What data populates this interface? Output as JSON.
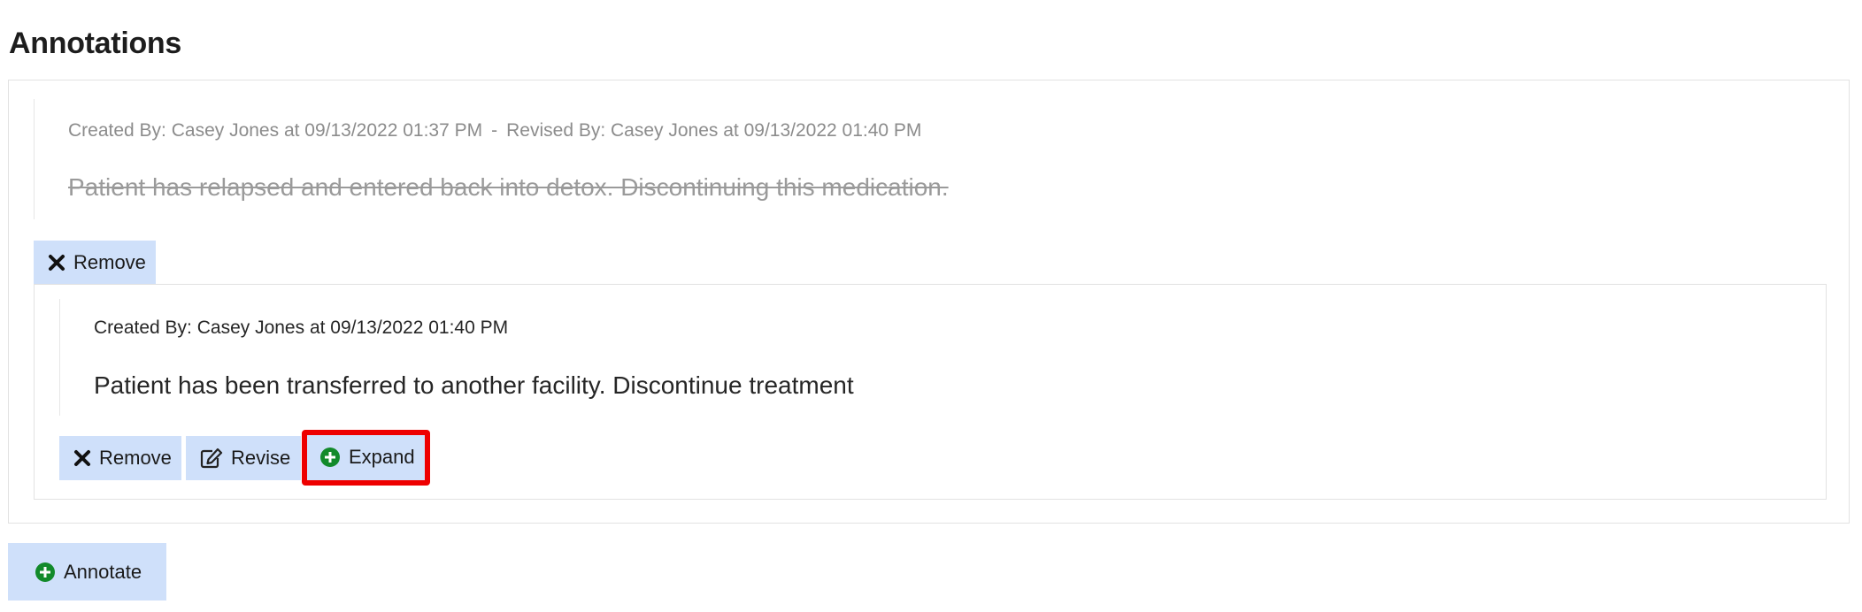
{
  "section_title": "Annotations",
  "annotations": [
    {
      "created": "Created By: Casey Jones at 09/13/2022 01:37 PM",
      "separator": "-",
      "revised": "Revised By: Casey Jones at 09/13/2022 01:40 PM",
      "text": "Patient has relapsed and entered back into detox. Discontinuing this medication.",
      "status": "revised",
      "actions": {
        "remove": "Remove"
      }
    },
    {
      "created": "Created By: Casey Jones at 09/13/2022 01:40 PM",
      "text": "Patient has been transferred to another facility. Discontinue treatment",
      "status": "active",
      "actions": {
        "remove": "Remove",
        "revise": "Revise",
        "expand": "Expand"
      }
    }
  ],
  "annotate_label": "Annotate",
  "colors": {
    "button_bg": "#cfe0fa",
    "plus_icon": "#128a2a",
    "highlight": "#ee0000",
    "meta_gray": "#8c8c8c"
  },
  "icons": [
    "close-icon",
    "edit-icon",
    "plus-circle-icon"
  ]
}
